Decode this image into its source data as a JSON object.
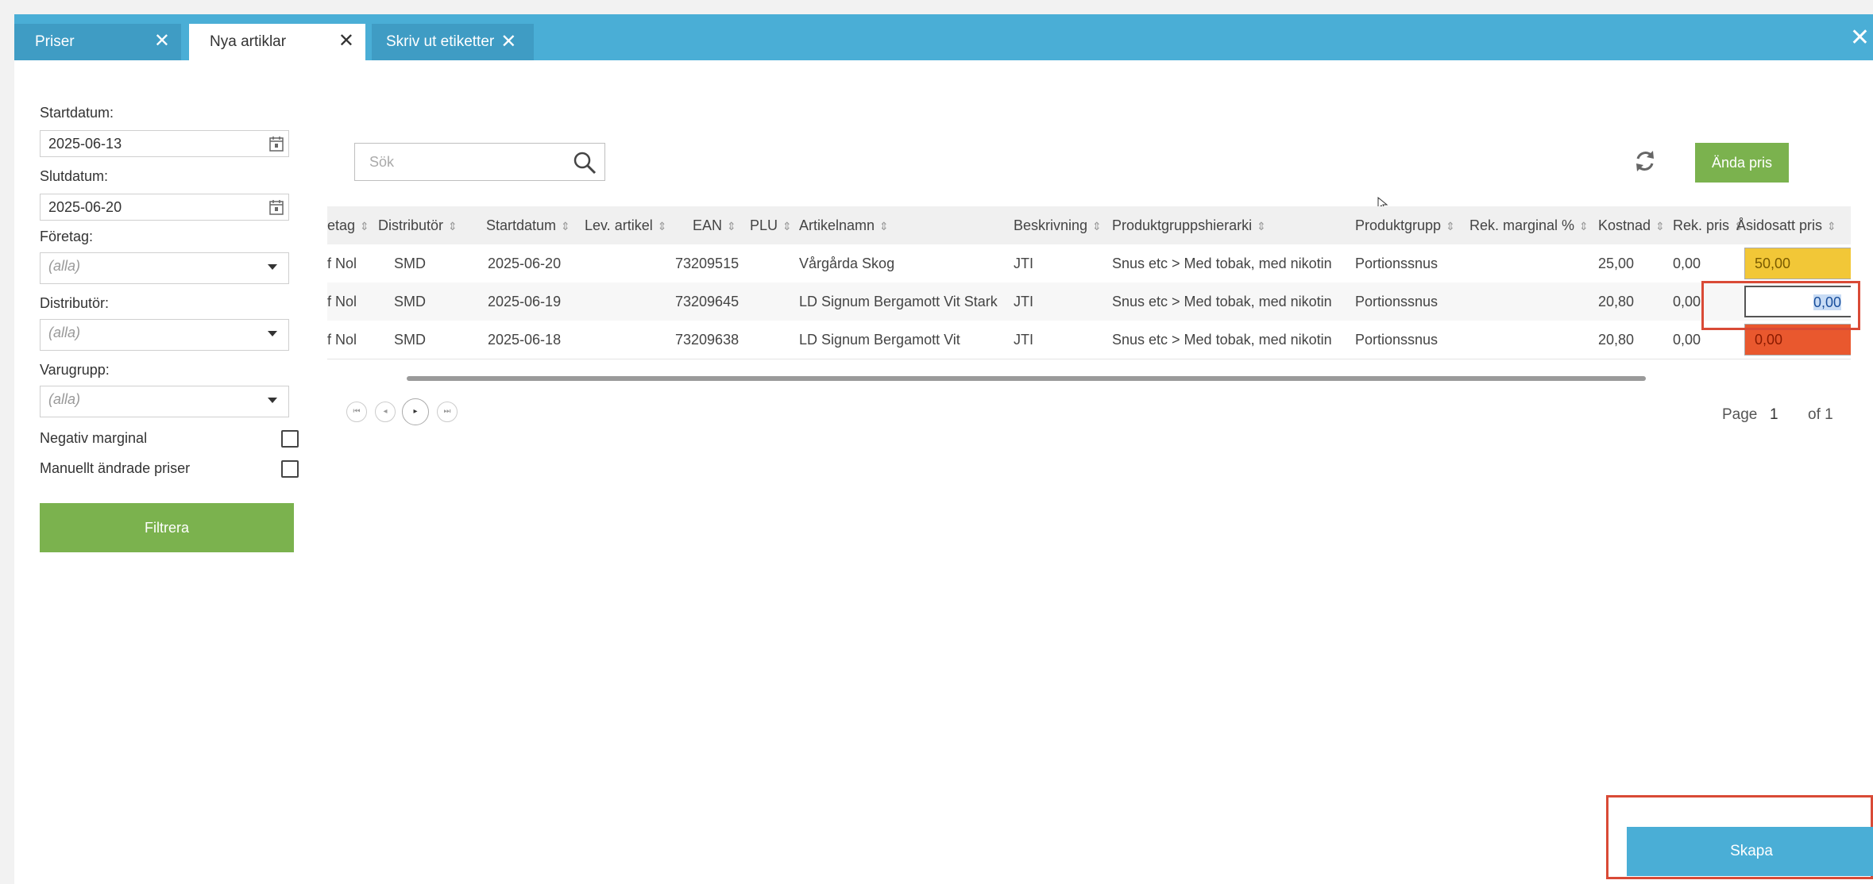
{
  "tabs": [
    {
      "label": "Priser",
      "active": false
    },
    {
      "label": "Nya artiklar",
      "active": true
    },
    {
      "label": "Skriv ut etiketter",
      "active": false
    }
  ],
  "close_glyph": "✕",
  "filters": {
    "start_label": "Startdatum:",
    "start_value": "2025-06-13",
    "end_label": "Slutdatum:",
    "end_value": "2025-06-20",
    "company_label": "Företag:",
    "company_value": "(alla)",
    "distributor_label": "Distributör:",
    "distributor_value": "(alla)",
    "group_label": "Varugrupp:",
    "group_value": "(alla)",
    "negative_margin_label": "Negativ marginal",
    "manual_prices_label": "Manuellt ändrade priser",
    "filter_button": "Filtrera"
  },
  "search": {
    "placeholder": "Sök"
  },
  "toolbar": {
    "change_price_button": "Ända pris"
  },
  "grid": {
    "headers": [
      "etag",
      "Distributör",
      "Startdatum",
      "Lev. artikel",
      "EAN",
      "PLU",
      "Artikelnamn",
      "Beskrivning",
      "Produktgruppshierarki",
      "Produktgrupp",
      "Rek. marginal %",
      "Kostnad",
      "Rek. pris",
      "Åsidosatt pris"
    ],
    "rows": [
      {
        "foretag": "f Nol",
        "distributor": "SMD",
        "startdatum": "2025-06-20",
        "ean": "73209515",
        "artikelnamn": "Vårgårda Skog",
        "beskrivning": "JTI",
        "hierarki": "Snus etc > Med tobak, med nikotin",
        "produktgrupp": "Portionssnus",
        "kostnad": "25,00",
        "rek_pris": "0,00",
        "asidosatt": "50,00",
        "status": "yellow"
      },
      {
        "foretag": "f Nol",
        "distributor": "SMD",
        "startdatum": "2025-06-19",
        "ean": "73209645",
        "artikelnamn": "LD Signum Bergamott Vit Stark",
        "beskrivning": "JTI",
        "hierarki": "Snus etc > Med tobak, med nikotin",
        "produktgrupp": "Portionssnus",
        "kostnad": "20,80",
        "rek_pris": "0,00",
        "asidosatt": "0,00",
        "status": "editing"
      },
      {
        "foretag": "f Nol",
        "distributor": "SMD",
        "startdatum": "2025-06-18",
        "ean": "73209638",
        "artikelnamn": "LD Signum Bergamott Vit",
        "beskrivning": "JTI",
        "hierarki": "Snus etc > Med tobak, med nikotin",
        "produktgrupp": "Portionssnus",
        "kostnad": "20,80",
        "rek_pris": "0,00",
        "asidosatt": "0,00",
        "status": "red"
      }
    ]
  },
  "pager": {
    "page_label": "Page",
    "page": "1",
    "of_label": "of 1"
  },
  "create_button": "Skapa",
  "colors": {
    "tabbar": "#4aaed6",
    "accent_green": "#7bb24e",
    "highlight": "#d94a36",
    "yellow": "#f2c737",
    "red": "#e9582e"
  }
}
